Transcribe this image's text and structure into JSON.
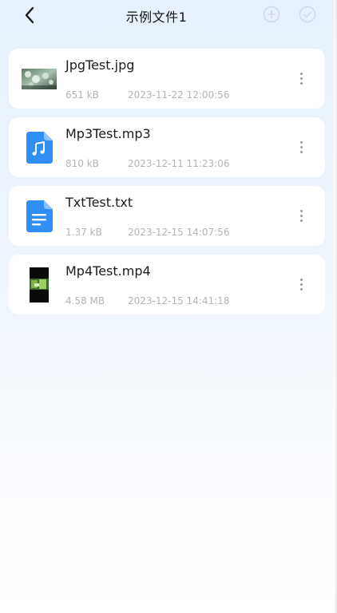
{
  "header": {
    "title": "示例文件1",
    "back_icon": "chevron-left-icon",
    "add_icon": "plus-circle-icon",
    "select_icon": "check-circle-icon"
  },
  "files": [
    {
      "name": "JpgTest.jpg",
      "size": "651 kB",
      "date": "2023-11-22 12:00:56",
      "type": "image"
    },
    {
      "name": "Mp3Test.mp3",
      "size": "810 kB",
      "date": "2023-12-11 11:23:06",
      "type": "audio"
    },
    {
      "name": "TxtTest.txt",
      "size": "1.37 kB",
      "date": "2023-12-15 14:07:56",
      "type": "text"
    },
    {
      "name": "Mp4Test.mp4",
      "size": "4.58 MB",
      "date": "2023-12-15 14:41:18",
      "type": "video"
    }
  ],
  "colors": {
    "file_icon_blue": "#2f8ff4",
    "secondary_text": "#b4b4b4",
    "header_icon_disabled": "#c9daf0"
  }
}
